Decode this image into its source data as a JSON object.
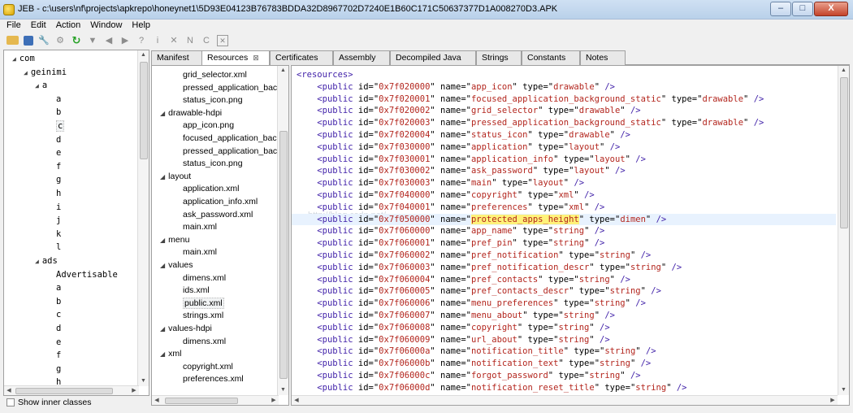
{
  "window": {
    "title": "JEB - c:\\users\\nf\\projects\\apkrepo\\honeynet1\\5D93E04123B76783BDDA32D8967702D7240E1B60C171C50637377D1A008270D3.APK",
    "minimize_label": "–",
    "maximize_label": "□",
    "close_label": "X"
  },
  "menu": [
    "File",
    "Edit",
    "Action",
    "Window",
    "Help"
  ],
  "toolbar_icons": [
    "open-folder-icon",
    "save-icon",
    "wrench-icon",
    "gear-icon",
    "refresh-icon",
    "dropdown-icon",
    "back-icon",
    "forward-icon",
    "help-icon",
    "info-icon",
    "x-icon",
    "n-icon",
    "c-icon",
    "boxed-x-icon"
  ],
  "tree": {
    "items": [
      {
        "label": "com",
        "depth": 0,
        "expanded": true
      },
      {
        "label": "geinimi",
        "depth": 1,
        "expanded": true
      },
      {
        "label": "a",
        "depth": 2,
        "expanded": true
      },
      {
        "label": "a",
        "depth": 3
      },
      {
        "label": "b",
        "depth": 3
      },
      {
        "label": "c",
        "depth": 3,
        "selected": true
      },
      {
        "label": "d",
        "depth": 3
      },
      {
        "label": "e",
        "depth": 3
      },
      {
        "label": "f",
        "depth": 3
      },
      {
        "label": "g",
        "depth": 3
      },
      {
        "label": "h",
        "depth": 3
      },
      {
        "label": "i",
        "depth": 3
      },
      {
        "label": "j",
        "depth": 3
      },
      {
        "label": "k",
        "depth": 3
      },
      {
        "label": "l",
        "depth": 3
      },
      {
        "label": "ads",
        "depth": 2,
        "expanded": true
      },
      {
        "label": "Advertisable",
        "depth": 3
      },
      {
        "label": "a",
        "depth": 3
      },
      {
        "label": "b",
        "depth": 3
      },
      {
        "label": "c",
        "depth": 3
      },
      {
        "label": "d",
        "depth": 3
      },
      {
        "label": "e",
        "depth": 3
      },
      {
        "label": "f",
        "depth": 3
      },
      {
        "label": "g",
        "depth": 3
      },
      {
        "label": "h",
        "depth": 3
      }
    ],
    "show_inner_classes": "Show inner classes"
  },
  "tabs": [
    {
      "label": "Manifest"
    },
    {
      "label": "Resources",
      "active": true
    },
    {
      "label": "Certificates"
    },
    {
      "label": "Assembly"
    },
    {
      "label": "Decompiled Java"
    },
    {
      "label": "Strings"
    },
    {
      "label": "Constants"
    },
    {
      "label": "Notes"
    }
  ],
  "resource_tree": [
    {
      "label": "grid_selector.xml",
      "depth": 2
    },
    {
      "label": "pressed_application_bac",
      "depth": 2
    },
    {
      "label": "status_icon.png",
      "depth": 2
    },
    {
      "label": "drawable-hdpi",
      "depth": 1,
      "expanded": true
    },
    {
      "label": "app_icon.png",
      "depth": 2
    },
    {
      "label": "focused_application_bac",
      "depth": 2
    },
    {
      "label": "pressed_application_bacl",
      "depth": 2
    },
    {
      "label": "status_icon.png",
      "depth": 2
    },
    {
      "label": "layout",
      "depth": 1,
      "expanded": true
    },
    {
      "label": "application.xml",
      "depth": 2
    },
    {
      "label": "application_info.xml",
      "depth": 2
    },
    {
      "label": "ask_password.xml",
      "depth": 2
    },
    {
      "label": "main.xml",
      "depth": 2
    },
    {
      "label": "menu",
      "depth": 1,
      "expanded": true
    },
    {
      "label": "main.xml",
      "depth": 2
    },
    {
      "label": "values",
      "depth": 1,
      "expanded": true
    },
    {
      "label": "dimens.xml",
      "depth": 2
    },
    {
      "label": "ids.xml",
      "depth": 2
    },
    {
      "label": "public.xml",
      "depth": 2,
      "selected": true
    },
    {
      "label": "strings.xml",
      "depth": 2
    },
    {
      "label": "values-hdpi",
      "depth": 1,
      "expanded": true
    },
    {
      "label": "dimens.xml",
      "depth": 2
    },
    {
      "label": "xml",
      "depth": 1,
      "expanded": true
    },
    {
      "label": "copyright.xml",
      "depth": 2
    },
    {
      "label": "preferences.xml",
      "depth": 2
    }
  ],
  "code": {
    "root_open": "<resources>",
    "highlight_index": 12,
    "watermark": "http://blog.csdn.net/",
    "lines": [
      {
        "id": "0x7f020000",
        "name": "app_icon",
        "type": "drawable"
      },
      {
        "id": "0x7f020001",
        "name": "focused_application_background_static",
        "type": "drawable"
      },
      {
        "id": "0x7f020002",
        "name": "grid_selector",
        "type": "drawable"
      },
      {
        "id": "0x7f020003",
        "name": "pressed_application_background_static",
        "type": "drawable"
      },
      {
        "id": "0x7f020004",
        "name": "status_icon",
        "type": "drawable"
      },
      {
        "id": "0x7f030000",
        "name": "application",
        "type": "layout"
      },
      {
        "id": "0x7f030001",
        "name": "application_info",
        "type": "layout"
      },
      {
        "id": "0x7f030002",
        "name": "ask_password",
        "type": "layout"
      },
      {
        "id": "0x7f030003",
        "name": "main",
        "type": "layout"
      },
      {
        "id": "0x7f040000",
        "name": "copyright",
        "type": "xml"
      },
      {
        "id": "0x7f040001",
        "name": "preferences",
        "type": "xml"
      },
      {
        "id": "0x7f050000",
        "name": "protected_apps_height",
        "type": "dimen"
      },
      {
        "id": "0x7f060000",
        "name": "app_name",
        "type": "string"
      },
      {
        "id": "0x7f060001",
        "name": "pref_pin",
        "type": "string"
      },
      {
        "id": "0x7f060002",
        "name": "pref_notification",
        "type": "string"
      },
      {
        "id": "0x7f060003",
        "name": "pref_notification_descr",
        "type": "string"
      },
      {
        "id": "0x7f060004",
        "name": "pref_contacts",
        "type": "string"
      },
      {
        "id": "0x7f060005",
        "name": "pref_contacts_descr",
        "type": "string"
      },
      {
        "id": "0x7f060006",
        "name": "menu_preferences",
        "type": "string"
      },
      {
        "id": "0x7f060007",
        "name": "menu_about",
        "type": "string"
      },
      {
        "id": "0x7f060008",
        "name": "copyright",
        "type": "string"
      },
      {
        "id": "0x7f060009",
        "name": "url_about",
        "type": "string"
      },
      {
        "id": "0x7f06000a",
        "name": "notification_title",
        "type": "string"
      },
      {
        "id": "0x7f06000b",
        "name": "notification_text",
        "type": "string"
      },
      {
        "id": "0x7f06000c",
        "name": "forgot_password",
        "type": "string"
      },
      {
        "id": "0x7f06000d",
        "name": "notification_reset_title",
        "type": "string"
      }
    ]
  },
  "colors": {
    "tag": "#3f1fa8",
    "value": "#b3261e",
    "highlight_line": "#e8f2fe",
    "highlight_word": "#fff27a"
  }
}
